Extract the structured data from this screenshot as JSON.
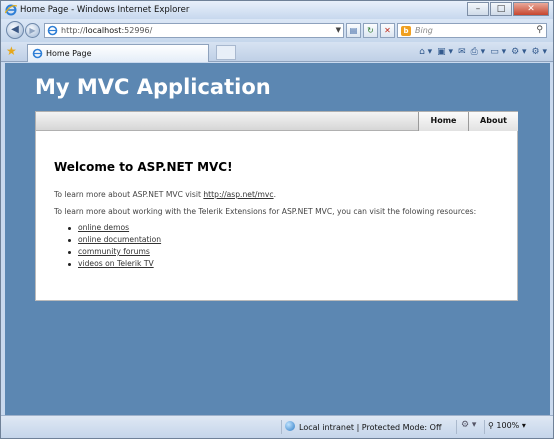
{
  "browser": {
    "window_title": "Home Page - Windows Internet Explorer",
    "buttons": {
      "minimize": "–",
      "maximize": "□",
      "close": "✕"
    },
    "address": {
      "prefix": "http://",
      "host": "localhost",
      "port": ":52996/"
    },
    "search_placeholder": "Bing",
    "tab_label": "Home Page",
    "status": {
      "zone": "Local intranet | Protected Mode: Off",
      "zoom": "100%"
    }
  },
  "site": {
    "title": "My MVC Application",
    "menu": [
      {
        "label": "Home"
      },
      {
        "label": "About"
      }
    ],
    "heading": "Welcome to ASP.NET MVC!",
    "para1_text": "To learn more about ASP.NET MVC visit ",
    "para1_link": "http://asp.net/mvc",
    "para1_end": ".",
    "para2": "To learn more about working with the Telerik Extensions for ASP.NET MVC, you can visit the folowing resources:",
    "resources": [
      "online demos",
      "online documentation",
      "community forums",
      "videos on Telerik TV"
    ]
  },
  "colors": {
    "page_background": "#5c87b2",
    "content_background": "#ffffff"
  }
}
